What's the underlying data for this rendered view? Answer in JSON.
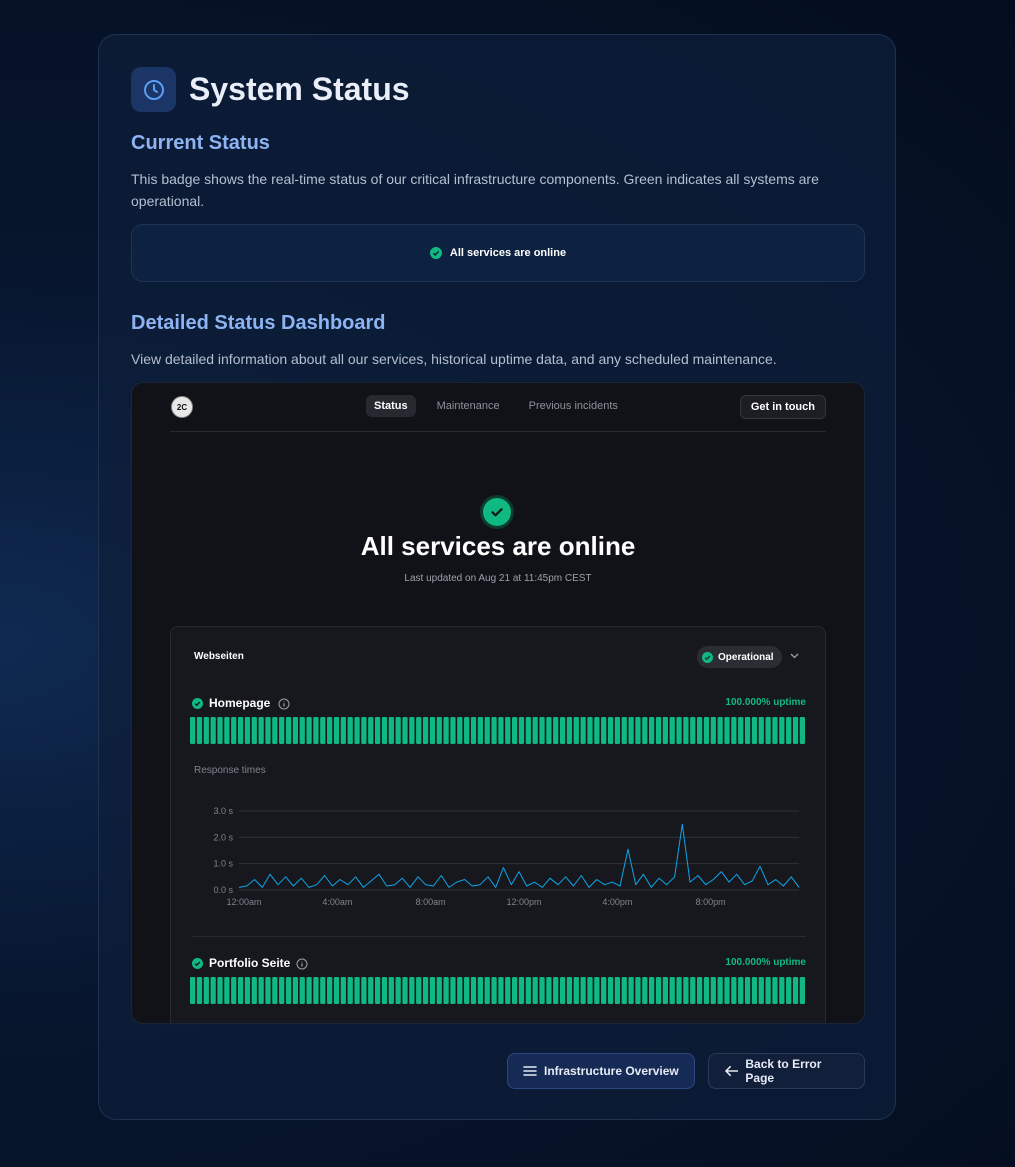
{
  "page": {
    "title": "System Status",
    "current_status": {
      "heading": "Current Status",
      "description": "This badge shows the real-time status of our critical infrastructure components. Green indicates all systems are operational.",
      "badge_text": "All services are online"
    },
    "detailed": {
      "heading": "Detailed Status Dashboard",
      "description": "View detailed information about all our services, historical uptime data, and any scheduled maintenance."
    },
    "buttons": {
      "infrastructure": "Infrastructure Overview",
      "back": "Back to Error Page"
    }
  },
  "dashboard": {
    "logo_text": "2C",
    "tabs": [
      "Status",
      "Maintenance",
      "Previous incidents"
    ],
    "active_tab": "Status",
    "contact_button": "Get in touch",
    "hero_title": "All services are online",
    "last_updated": "Last updated on Aug 21 at 11:45pm CEST",
    "group": {
      "name": "Webseiten",
      "status": "Operational",
      "response_label": "Response times",
      "services": [
        {
          "name": "Homepage",
          "uptime": "100.000% uptime"
        },
        {
          "name": "Portfolio Seite",
          "uptime": "100.000% uptime"
        }
      ]
    }
  },
  "colors": {
    "operational": "#10b981",
    "accent": "#8db3f2",
    "chart_line": "#0ea5e9"
  },
  "chart_data": {
    "type": "line",
    "x_ticks": [
      "12:00am",
      "4:00am",
      "8:00am",
      "12:00pm",
      "4:00pm",
      "8:00pm"
    ],
    "y_ticks": [
      "0.0 s",
      "1.0 s",
      "2.0 s",
      "3.0 s"
    ],
    "ylim": [
      0,
      3.0
    ],
    "xlim": [
      0,
      24
    ],
    "grid": true,
    "series": [
      {
        "x": [
          0,
          0.33,
          0.67,
          1,
          1.33,
          1.67,
          2,
          2.33,
          2.67,
          3,
          3.33,
          3.67,
          4,
          4.33,
          4.67,
          5,
          5.33,
          5.67,
          6,
          6.33,
          6.67,
          7,
          7.33,
          7.67,
          8,
          8.33,
          8.67,
          9,
          9.33,
          9.67,
          10,
          10.33,
          10.67,
          11,
          11.33,
          11.67,
          12,
          12.33,
          12.67,
          13,
          13.33,
          13.67,
          14,
          14.33,
          14.67,
          15,
          15.33,
          15.67,
          16,
          16.33,
          16.67,
          17,
          17.33,
          17.67,
          18,
          18.33,
          18.67,
          19,
          19.33,
          19.67,
          20,
          20.33,
          20.67,
          21,
          21.33,
          21.67,
          22,
          22.33,
          22.67,
          23,
          23.33,
          23.67,
          24
        ],
        "y": [
          0.1,
          0.15,
          0.4,
          0.1,
          0.6,
          0.2,
          0.5,
          0.15,
          0.45,
          0.1,
          0.2,
          0.55,
          0.15,
          0.4,
          0.2,
          0.5,
          0.1,
          0.35,
          0.6,
          0.15,
          0.2,
          0.45,
          0.1,
          0.5,
          0.2,
          0.15,
          0.55,
          0.1,
          0.3,
          0.4,
          0.15,
          0.2,
          0.5,
          0.1,
          0.85,
          0.2,
          0.7,
          0.15,
          0.3,
          0.1,
          0.45,
          0.2,
          0.5,
          0.15,
          0.55,
          0.1,
          0.4,
          0.2,
          0.3,
          0.15,
          1.55,
          0.2,
          0.6,
          0.1,
          0.45,
          0.2,
          0.5,
          2.5,
          0.3,
          0.55,
          0.2,
          0.4,
          0.7,
          0.3,
          0.6,
          0.2,
          0.35,
          0.9,
          0.2,
          0.4,
          0.15,
          0.5,
          0.1
        ]
      }
    ]
  },
  "uptime_bars": {
    "homepage_days": 90,
    "portfolio_days": 90,
    "fraction_operational": 1.0
  }
}
